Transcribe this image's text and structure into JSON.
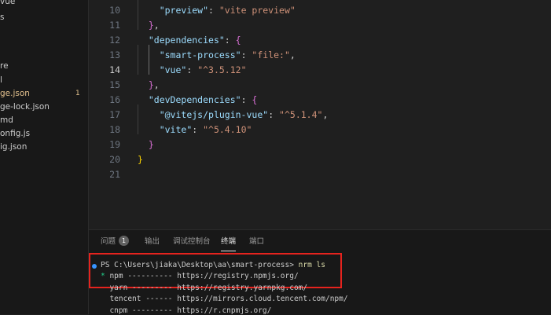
{
  "sidebar": {
    "items": [
      {
        "label": "vue",
        "active": false,
        "badge": ""
      },
      {
        "label": "s",
        "active": false,
        "badge": ""
      },
      {
        "label": "",
        "active": false,
        "badge": ""
      },
      {
        "label": "",
        "active": false,
        "badge": ""
      },
      {
        "label": "re",
        "active": false,
        "badge": ""
      },
      {
        "label": "l",
        "active": false,
        "badge": ""
      },
      {
        "label": "ge.json",
        "active": true,
        "badge": "1"
      },
      {
        "label": "ge-lock.json",
        "active": false,
        "badge": ""
      },
      {
        "label": "md",
        "active": false,
        "badge": ""
      },
      {
        "label": "onfig.js",
        "active": false,
        "badge": ""
      },
      {
        "label": "ig.json",
        "active": false,
        "badge": ""
      }
    ]
  },
  "editor": {
    "current_line": 14,
    "lines": [
      {
        "num": "10",
        "tokens": [
          {
            "t": "    ",
            "c": "p"
          },
          {
            "t": "\"preview\"",
            "c": "k"
          },
          {
            "t": ": ",
            "c": "p"
          },
          {
            "t": "\"vite preview\"",
            "c": "s"
          }
        ]
      },
      {
        "num": "11",
        "tokens": [
          {
            "t": "  ",
            "c": "p"
          },
          {
            "t": "}",
            "c": "b2"
          },
          {
            "t": ",",
            "c": "p"
          }
        ]
      },
      {
        "num": "12",
        "tokens": [
          {
            "t": "  ",
            "c": "p"
          },
          {
            "t": "\"dependencies\"",
            "c": "k"
          },
          {
            "t": ": ",
            "c": "p"
          },
          {
            "t": "{",
            "c": "b2"
          }
        ]
      },
      {
        "num": "13",
        "tokens": [
          {
            "t": "    ",
            "c": "p"
          },
          {
            "t": "\"smart-process\"",
            "c": "k"
          },
          {
            "t": ": ",
            "c": "p"
          },
          {
            "t": "\"file:\"",
            "c": "s"
          },
          {
            "t": ",",
            "c": "p"
          }
        ]
      },
      {
        "num": "14",
        "tokens": [
          {
            "t": "    ",
            "c": "p"
          },
          {
            "t": "\"vue\"",
            "c": "k"
          },
          {
            "t": ": ",
            "c": "p"
          },
          {
            "t": "\"^3.5.12\"",
            "c": "s"
          }
        ]
      },
      {
        "num": "15",
        "tokens": [
          {
            "t": "  ",
            "c": "p"
          },
          {
            "t": "}",
            "c": "b2"
          },
          {
            "t": ",",
            "c": "p"
          }
        ]
      },
      {
        "num": "16",
        "tokens": [
          {
            "t": "  ",
            "c": "p"
          },
          {
            "t": "\"devDependencies\"",
            "c": "k"
          },
          {
            "t": ": ",
            "c": "p"
          },
          {
            "t": "{",
            "c": "b2"
          }
        ]
      },
      {
        "num": "17",
        "tokens": [
          {
            "t": "    ",
            "c": "p"
          },
          {
            "t": "\"@vitejs/plugin-vue\"",
            "c": "k"
          },
          {
            "t": ": ",
            "c": "p"
          },
          {
            "t": "\"^5.1.4\"",
            "c": "s"
          },
          {
            "t": ",",
            "c": "p"
          }
        ]
      },
      {
        "num": "18",
        "tokens": [
          {
            "t": "    ",
            "c": "p"
          },
          {
            "t": "\"vite\"",
            "c": "k"
          },
          {
            "t": ": ",
            "c": "p"
          },
          {
            "t": "\"^5.4.10\"",
            "c": "s"
          }
        ]
      },
      {
        "num": "19",
        "tokens": [
          {
            "t": "  ",
            "c": "p"
          },
          {
            "t": "}",
            "c": "b2"
          }
        ]
      },
      {
        "num": "20",
        "tokens": [
          {
            "t": "}",
            "c": "b"
          }
        ]
      },
      {
        "num": "21",
        "tokens": []
      }
    ]
  },
  "panel": {
    "tabs": [
      {
        "label": "问题",
        "badge": "1",
        "active": false
      },
      {
        "label": "输出",
        "badge": "",
        "active": false
      },
      {
        "label": "调试控制台",
        "badge": "",
        "active": false
      },
      {
        "label": "终端",
        "badge": "",
        "active": true
      },
      {
        "label": "端口",
        "badge": "",
        "active": false
      }
    ],
    "terminal": {
      "prompt": "PS C:\\Users\\jiaka\\Desktop\\aa\\smart-process> ",
      "command": "nrm ls",
      "registries": [
        {
          "mark": "*",
          "line": " npm ---------- https://registry.npmjs.org/"
        },
        {
          "mark": " ",
          "line": " yarn --------- https://registry.yarnpkg.com/"
        },
        {
          "mark": " ",
          "line": " tencent ------ https://mirrors.cloud.tencent.com/npm/"
        },
        {
          "mark": " ",
          "line": " cnpm --------- https://r.cnpmjs.org/"
        }
      ]
    }
  },
  "colors": {
    "highlight_box": "#e5231e",
    "json_key": "#9cdcfe",
    "json_string": "#ce9178",
    "active_file": "#e2c08d"
  }
}
